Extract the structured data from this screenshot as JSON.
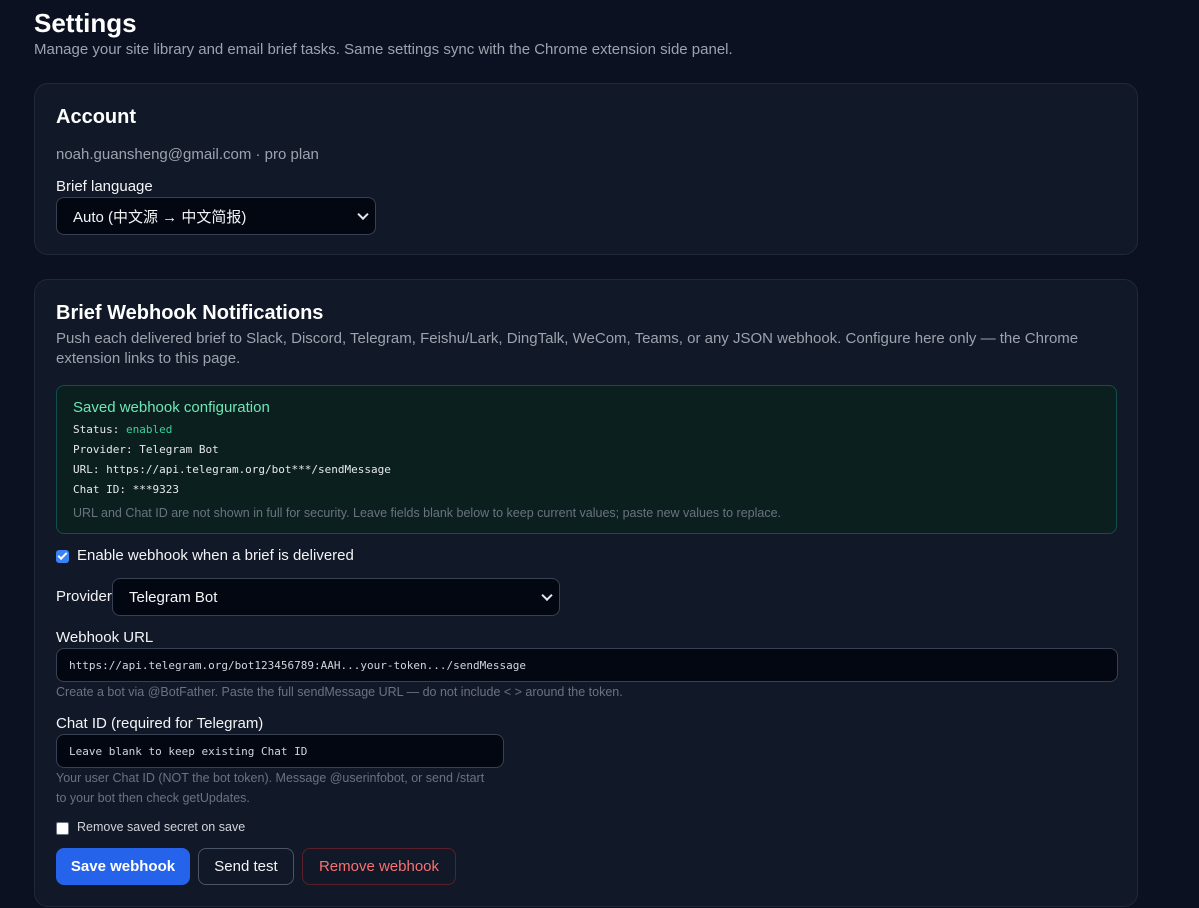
{
  "header": {
    "title": "Settings",
    "subtitle": "Manage your site library and email brief tasks. Same settings sync with the Chrome extension side panel."
  },
  "account": {
    "title": "Account",
    "user_line": "noah.guansheng@gmail.com · pro plan",
    "brief_language_label": "Brief language",
    "brief_language_value": "Auto (中文源 → 中文简报)"
  },
  "webhook": {
    "title": "Brief Webhook Notifications",
    "description": "Push each delivered brief to Slack, Discord, Telegram, Feishu/Lark, DingTalk, WeCom, Teams, or any JSON webhook. Configure here only — the Chrome extension links to this page.",
    "saved": {
      "title": "Saved webhook configuration",
      "status_key": "Status:",
      "status_value": "enabled",
      "provider_line": "Provider: Telegram Bot",
      "url_line": "URL: https://api.telegram.org/bot***/sendMessage",
      "chat_id_line": "Chat ID: ***9323",
      "note": "URL and Chat ID are not shown in full for security. Leave fields blank below to keep current values; paste new values to replace."
    },
    "enable_label": "Enable webhook when a brief is delivered",
    "enable_checked": true,
    "provider_label": "Provider",
    "provider_value": "Telegram Bot",
    "url_label": "Webhook URL",
    "url_placeholder": "https://api.telegram.org/bot123456789:AAH...your-token.../sendMessage",
    "url_hint": "Create a bot via @BotFather. Paste the full sendMessage URL — do not include < > around the token.",
    "chat_id_label": "Chat ID (required for Telegram)",
    "chat_id_placeholder": "Leave blank to keep existing Chat ID",
    "chat_id_hint_1": "Your user Chat ID (NOT the bot token). Message @userinfobot, or send /start",
    "chat_id_hint_2": "to your bot then check getUpdates.",
    "remove_secret_label": "Remove saved secret on save",
    "remove_secret_checked": false,
    "buttons": {
      "save": "Save webhook",
      "test": "Send test",
      "remove": "Remove webhook"
    }
  },
  "colors": {
    "background": "#0b1120",
    "card": "#111827",
    "primary": "#2563eb",
    "success": "#34d399",
    "danger": "#f87171"
  }
}
